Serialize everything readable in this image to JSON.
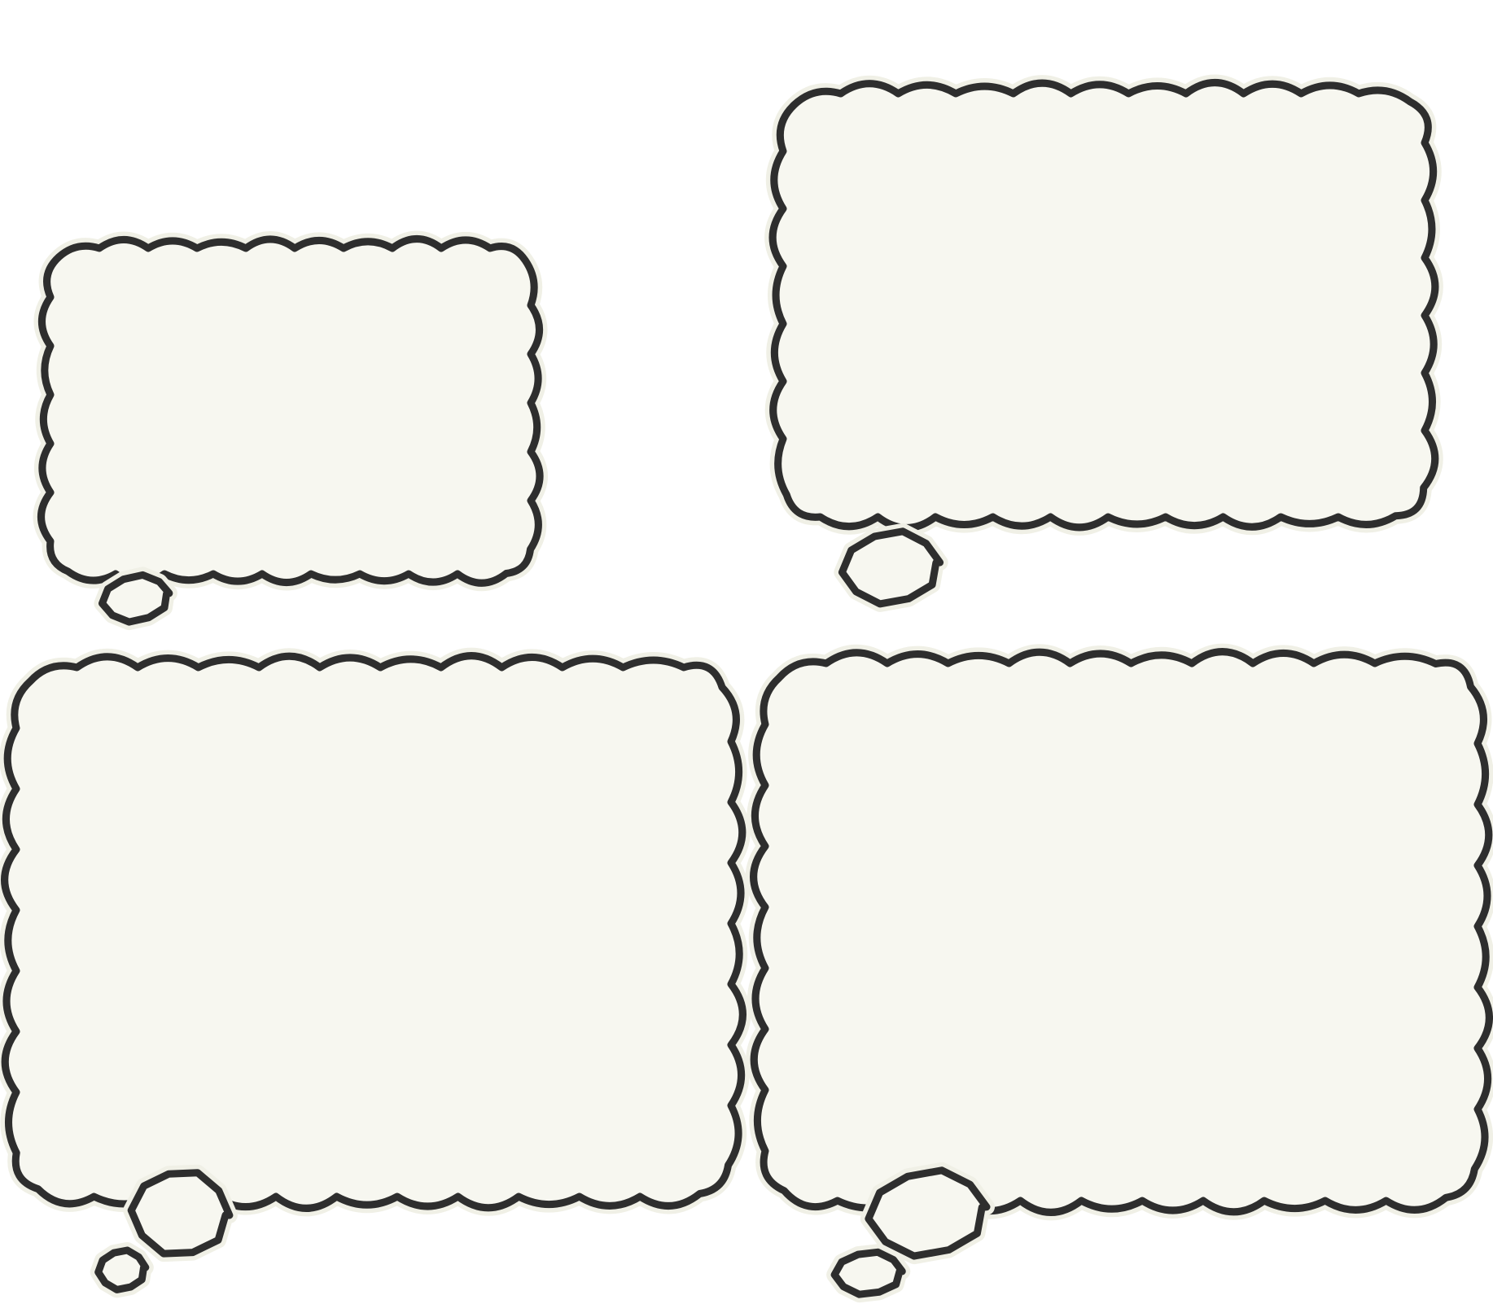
{
  "title": "",
  "colors": {
    "background": "#ffffff",
    "bubble_fill": "#f7f7f0",
    "bubble_outline": "#2e2e2e",
    "halo": "#f0f0e6"
  },
  "bubbles": [
    {
      "name": "thought-bubble-top-left",
      "text": ""
    },
    {
      "name": "thought-bubble-top-right",
      "text": ""
    },
    {
      "name": "thought-bubble-bottom-left",
      "text": ""
    },
    {
      "name": "thought-bubble-bottom-right",
      "text": ""
    }
  ]
}
